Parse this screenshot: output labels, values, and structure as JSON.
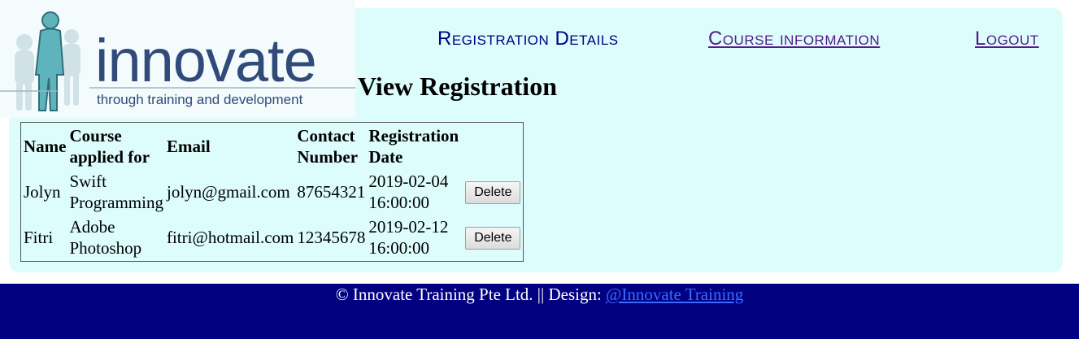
{
  "brand": {
    "name": "innovate",
    "tagline": "through training and development"
  },
  "nav": {
    "registration_details": "Registration Details",
    "course_information": "Course information",
    "logout": "Logout"
  },
  "page_title": "View Registration",
  "table": {
    "headers": {
      "name": "Name",
      "course_line1": "Course",
      "course_line2": "applied for",
      "email": "Email",
      "contact_line1": "Contact",
      "contact_line2": "Number",
      "date_line1": "Registration",
      "date_line2": "Date"
    },
    "rows": [
      {
        "name": "Jolyn",
        "course_line1": "Swift",
        "course_line2": "Programming",
        "email": "jolyn@gmail.com",
        "contact": "87654321",
        "date": "2019-02-04",
        "time": "16:00:00",
        "action": "Delete"
      },
      {
        "name": "Fitri",
        "course_line1": "Adobe",
        "course_line2": "Photoshop",
        "email": "fitri@hotmail.com",
        "contact": "12345678",
        "date": "2019-02-12",
        "time": "16:00:00",
        "action": "Delete"
      }
    ]
  },
  "footer": {
    "text": "© Innovate Training Pte Ltd. || Design: ",
    "link": "@Innovate Training"
  },
  "colors": {
    "panel": "#ddfcfc",
    "footer": "#000080",
    "brand": "#304a79",
    "brand_accent": "#5fb3bd"
  }
}
